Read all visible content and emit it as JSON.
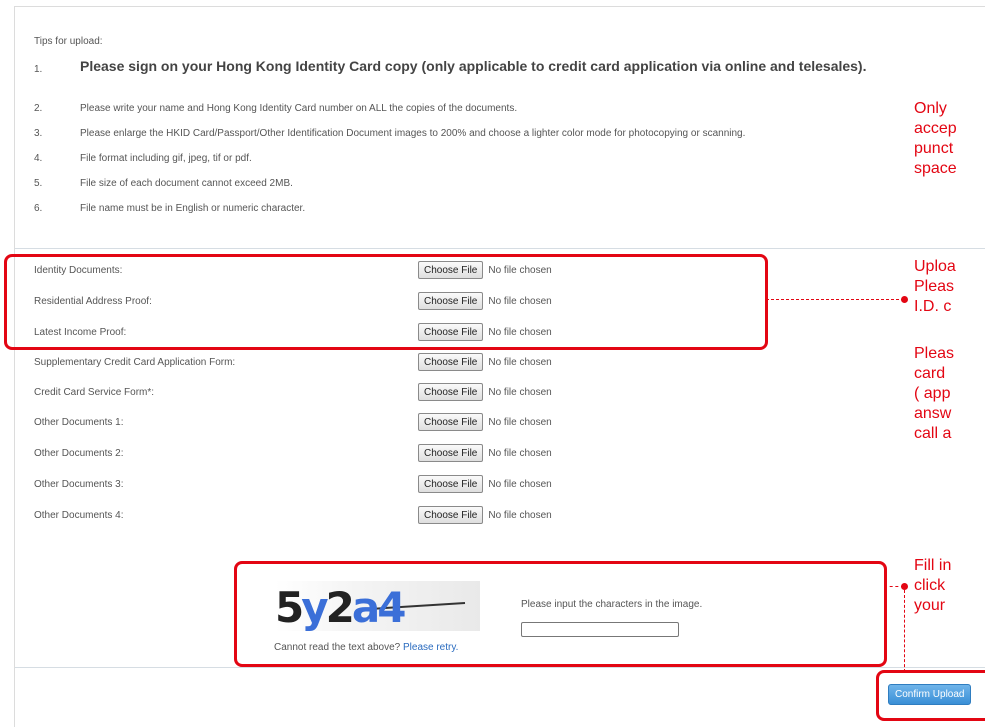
{
  "tips": {
    "title": "Tips for upload:",
    "items": [
      {
        "num": "1.",
        "text": "Please sign on your Hong Kong Identity Card copy (only applicable to credit card application via online and telesales)."
      },
      {
        "num": "2.",
        "text": "Please write your name and Hong Kong Identity Card number on ALL the copies of the documents."
      },
      {
        "num": "3.",
        "text": "Please enlarge the HKID Card/Passport/Other Identification Document images to 200% and choose a lighter color mode for photocopying or scanning."
      },
      {
        "num": "4.",
        "text": "File format including gif, jpeg, tif or pdf."
      },
      {
        "num": "5.",
        "text": "File size of each document cannot exceed 2MB."
      },
      {
        "num": "6.",
        "text": "File name must be in English or numeric character."
      }
    ]
  },
  "documents": [
    {
      "label": "Identity Documents:",
      "button": "Choose File",
      "status": "No file chosen"
    },
    {
      "label": "Residential Address Proof:",
      "button": "Choose File",
      "status": "No file chosen"
    },
    {
      "label": "Latest Income Proof:",
      "button": "Choose File",
      "status": "No file chosen"
    },
    {
      "label": "Supplementary Credit Card Application Form:",
      "button": "Choose File",
      "status": "No file chosen"
    },
    {
      "label": "Credit Card Service Form*:",
      "button": "Choose File",
      "status": "No file chosen"
    },
    {
      "label": "Other Documents 1:",
      "button": "Choose File",
      "status": "No file chosen"
    },
    {
      "label": "Other Documents 2:",
      "button": "Choose File",
      "status": "No file chosen"
    },
    {
      "label": "Other Documents 3:",
      "button": "Choose File",
      "status": "No file chosen"
    },
    {
      "label": "Other Documents 4:",
      "button": "Choose File",
      "status": "No file chosen"
    }
  ],
  "captcha": {
    "image_text": "5y2a4",
    "instruction": "Please input the characters in the image.",
    "input_value": "",
    "help_text": "Cannot read the text above?",
    "retry_link": "Please retry."
  },
  "confirm_button": "Confirm Upload",
  "notes": [
    {
      "lines": [
        "Only",
        "accep",
        "punct",
        "space"
      ]
    },
    {
      "lines": [
        "Uploa",
        "Pleas",
        "I.D. c"
      ]
    },
    {
      "lines": [
        "Pleas",
        "card",
        "( app",
        "answ",
        "call a"
      ]
    },
    {
      "lines": [
        "Fill in",
        "click",
        "your"
      ]
    }
  ],
  "colors": {
    "annotation": "#e30613",
    "button_blue": "#3a8fd6",
    "link": "#2a6bbf"
  }
}
